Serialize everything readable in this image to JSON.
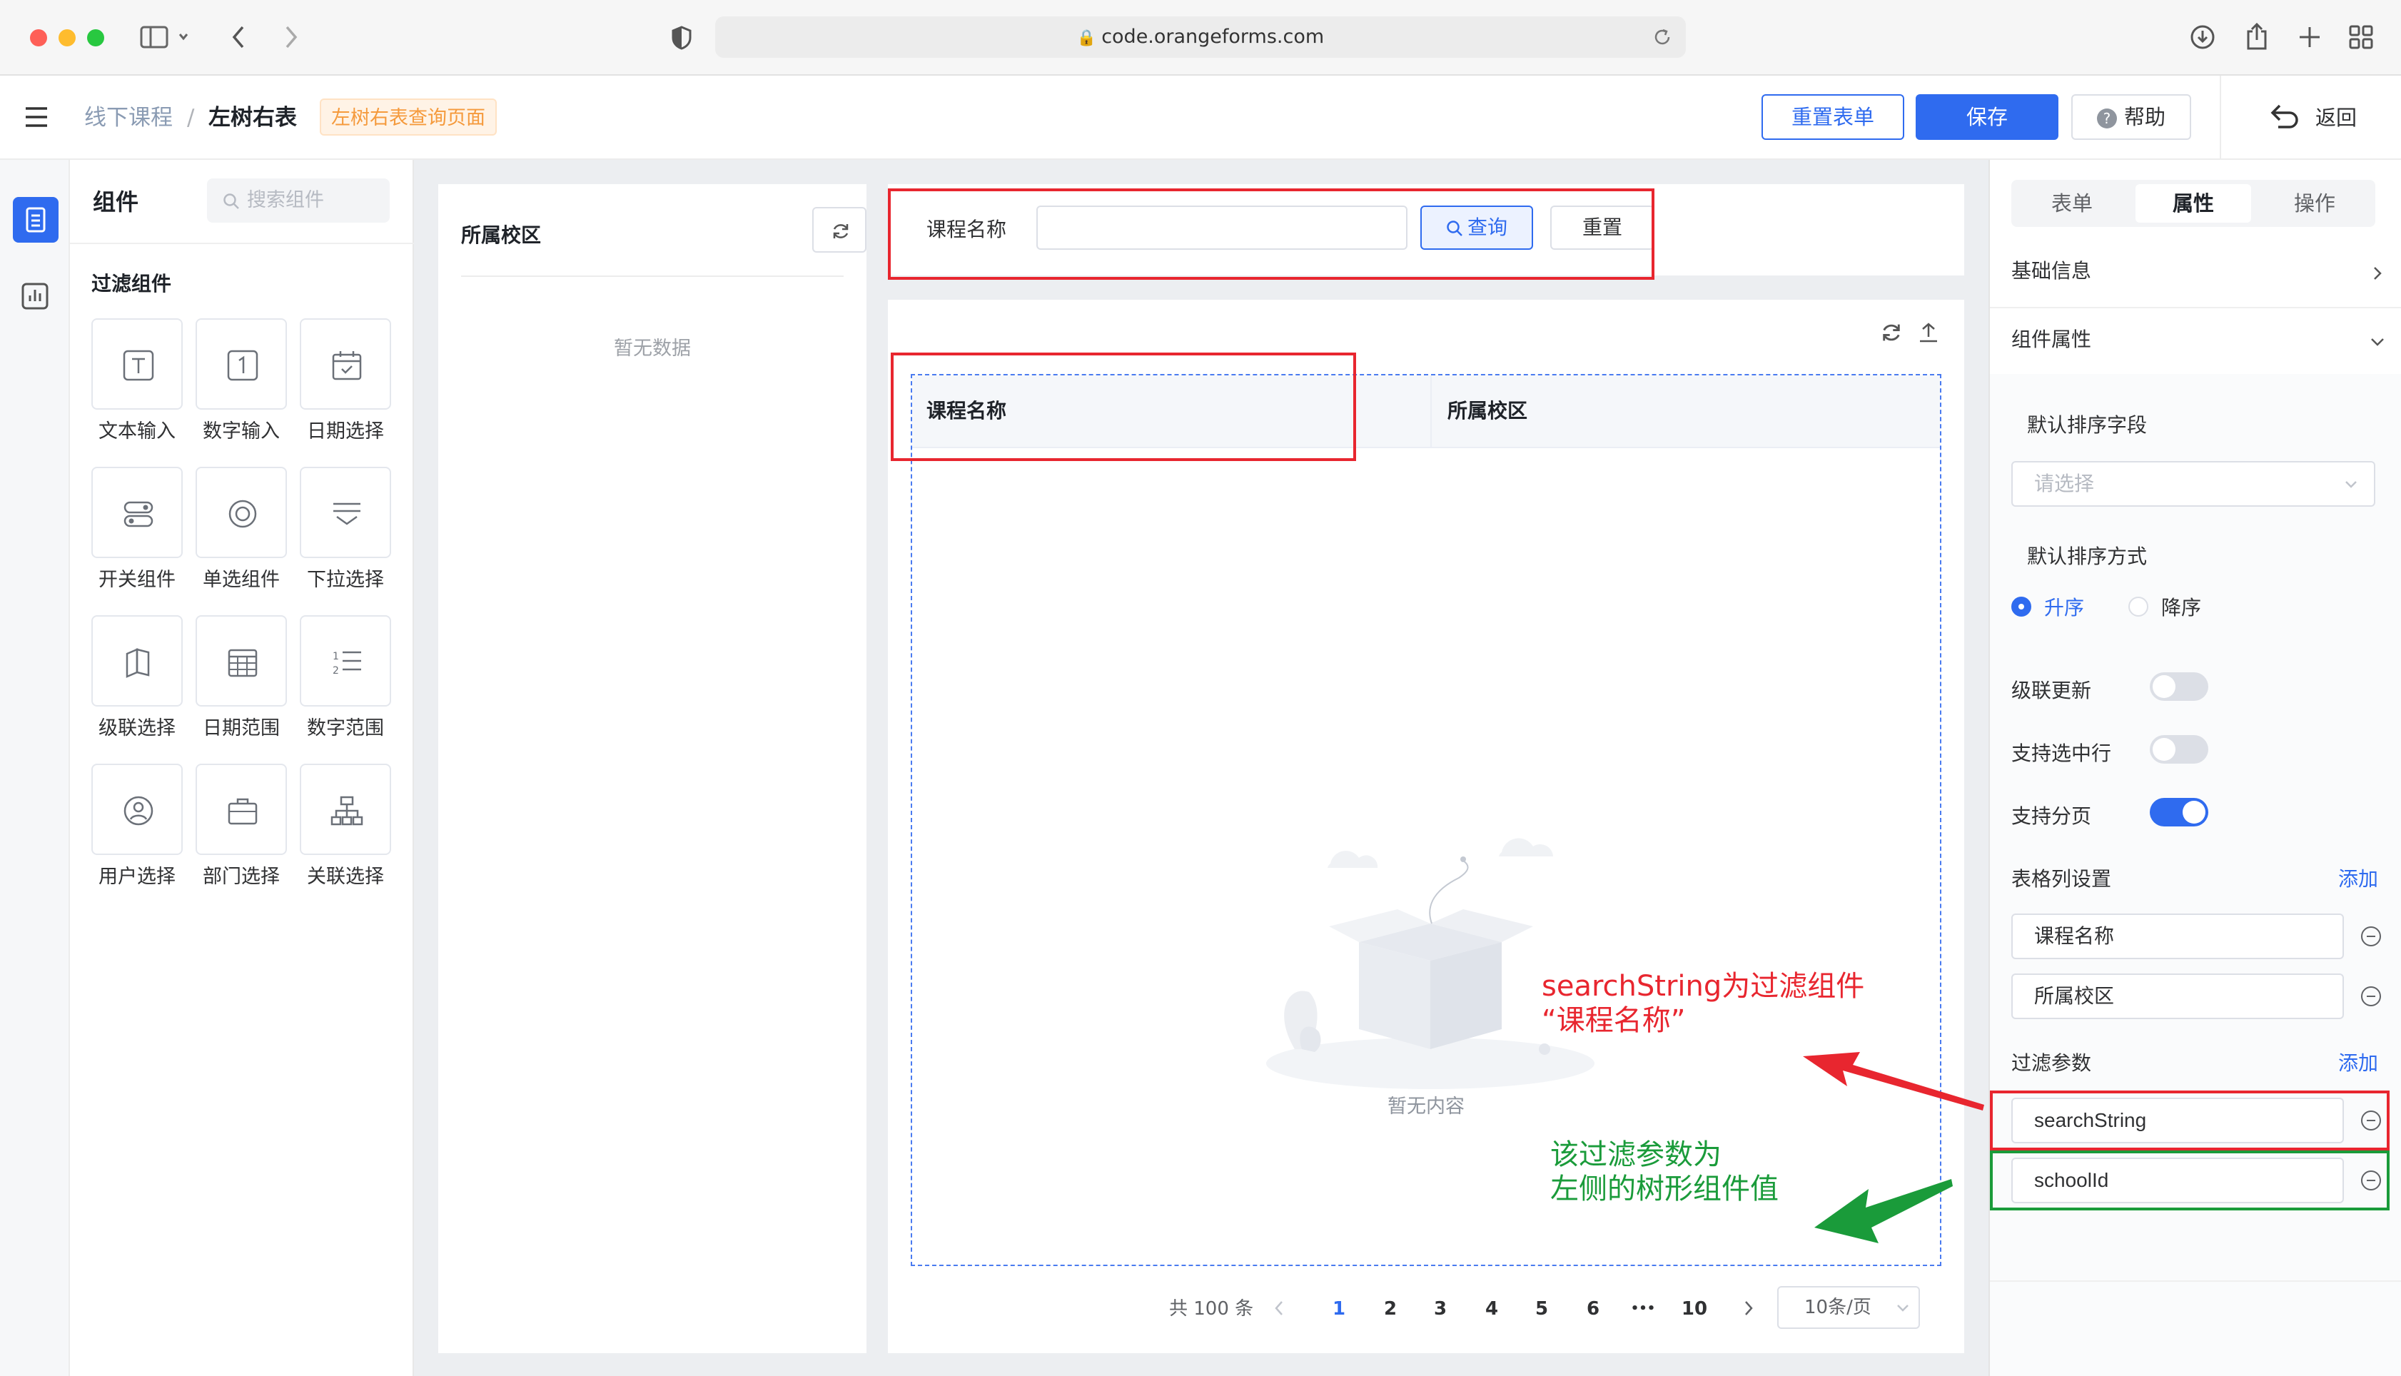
{
  "browser": {
    "url": "code.orangeforms.com",
    "traffic_lights": [
      "#fe5f57",
      "#febc2e",
      "#28c840"
    ]
  },
  "header": {
    "breadcrumb": [
      "线下课程",
      "/",
      "左树右表"
    ],
    "page_tag": "左树右表查询页面",
    "buttons": {
      "reset_form": "重置表单",
      "save": "保存",
      "help": "帮助",
      "back": "返回"
    }
  },
  "components_panel": {
    "title": "组件",
    "search_placeholder": "搜索组件",
    "section_title": "过滤组件",
    "items": [
      "文本输入",
      "数字输入",
      "日期选择",
      "开关组件",
      "单选组件",
      "下拉选择",
      "级联选择",
      "日期范围",
      "数字范围",
      "用户选择",
      "部门选择",
      "关联选择"
    ]
  },
  "tree_panel": {
    "title": "所属校区",
    "empty_text": "暂无数据"
  },
  "filter_bar": {
    "label": "课程名称",
    "query_button": "查询",
    "reset_button": "重置"
  },
  "table": {
    "columns": [
      "课程名称",
      "所属校区"
    ],
    "empty_text": "暂无内容"
  },
  "pagination": {
    "total_text": "共 100 条",
    "pages": [
      "1",
      "2",
      "3",
      "4",
      "5",
      "6",
      "•••",
      "10"
    ],
    "current_page": "1",
    "page_size": "10条/页"
  },
  "annotations": {
    "red_line1": "searchString为过滤组件",
    "red_line2": "“课程名称”",
    "green_line1": "该过滤参数为",
    "green_line2": "左侧的树形组件值",
    "red_color": "#e8262f",
    "green_color": "#1a9b3a"
  },
  "properties_panel": {
    "tabs": [
      "表单",
      "属性",
      "操作"
    ],
    "active_tab": "属性",
    "basic_info": "基础信息",
    "component_props": "组件属性",
    "default_sort_field_label": "默认排序字段",
    "default_sort_field_placeholder": "请选择",
    "default_sort_order_label": "默认排序方式",
    "sort_options": [
      "升序",
      "降序"
    ],
    "selected_sort": "升序",
    "cascade_update": {
      "label": "级联更新",
      "on": false
    },
    "row_select": {
      "label": "支持选中行",
      "on": false
    },
    "paging": {
      "label": "支持分页",
      "on": true
    },
    "table_columns_label": "表格列设置",
    "add_label": "添加",
    "table_columns": [
      "课程名称",
      "所属校区"
    ],
    "filter_params_label": "过滤参数",
    "filter_params": [
      "searchString",
      "schoolId"
    ],
    "accent_color": "#2f6bef"
  }
}
